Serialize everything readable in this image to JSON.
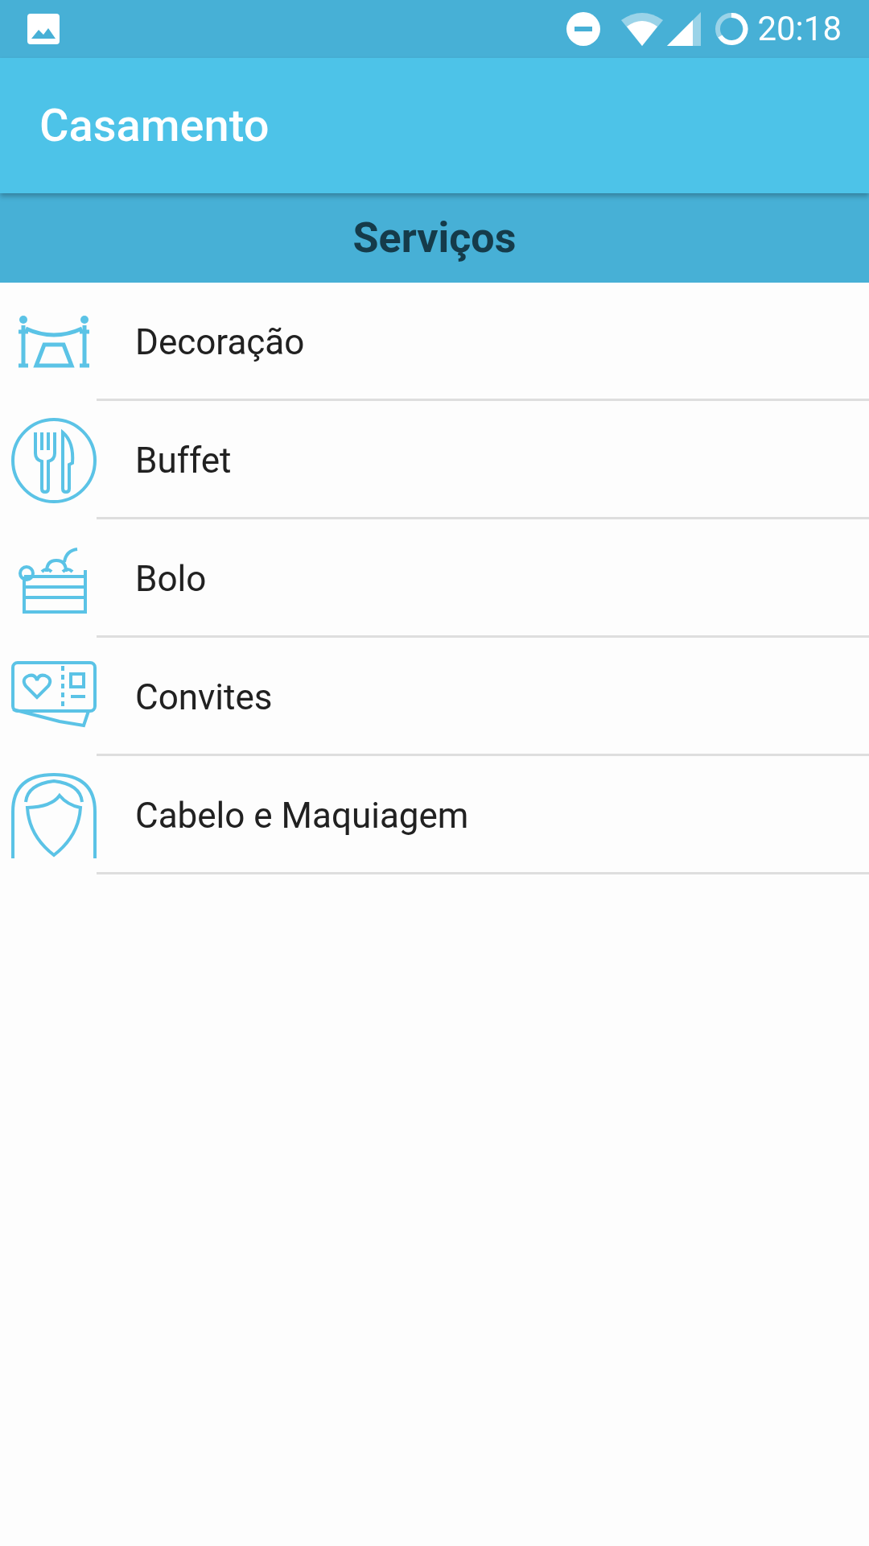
{
  "status_bar": {
    "time": "20:18"
  },
  "app_bar": {
    "title": "Casamento"
  },
  "section_header": {
    "title": "Serviços"
  },
  "services": [
    {
      "label": "Decoração"
    },
    {
      "label": "Buffet"
    },
    {
      "label": "Bolo"
    },
    {
      "label": "Convites"
    },
    {
      "label": "Cabelo e Maquiagem"
    }
  ]
}
